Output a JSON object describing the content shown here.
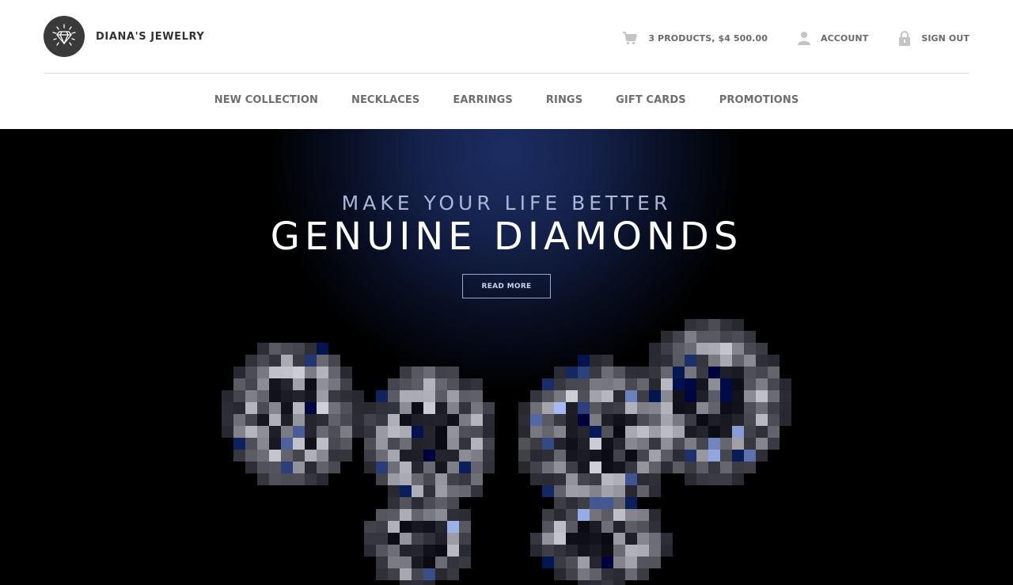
{
  "brand": {
    "name": "DIANA'S JEWELRY",
    "logo_icon": "diamond-icon"
  },
  "top_links": {
    "cart": {
      "label": "3 PRODUCTS, $4 500.00",
      "icon": "cart-icon"
    },
    "account": {
      "label": "ACCOUNT",
      "icon": "user-icon"
    },
    "sign_out": {
      "label": "SIGN OUT",
      "icon": "lock-icon"
    }
  },
  "nav": [
    {
      "label": "NEW COLLECTION"
    },
    {
      "label": "NECKLACES"
    },
    {
      "label": "EARRINGS"
    },
    {
      "label": "RINGS"
    },
    {
      "label": "GIFT CARDS"
    },
    {
      "label": "PROMOTIONS"
    }
  ],
  "hero": {
    "subtitle": "MAKE YOUR LIFE BETTER",
    "title": "GENUINE DIAMONDS",
    "button": "READ MORE"
  },
  "colors": {
    "hero_bg": "#000000",
    "hero_glow": "#1c2d63",
    "nav_text": "#6e6e6e",
    "logo_bg": "#3a3a3a"
  }
}
